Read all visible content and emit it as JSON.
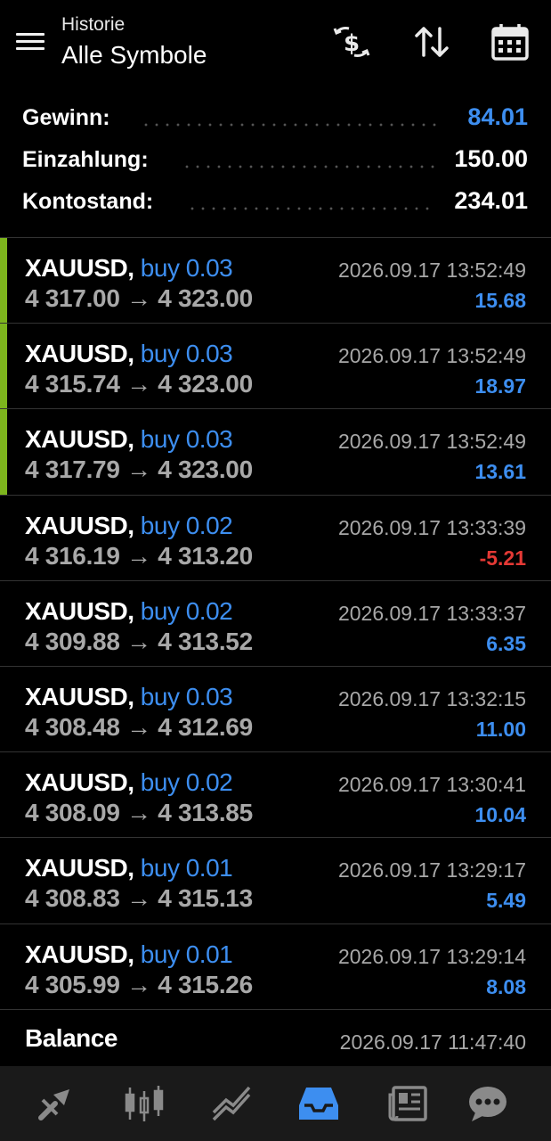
{
  "header": {
    "subtitle": "Historie",
    "title": "Alle Symbole",
    "icons": [
      "menu-icon",
      "currency-exchange-icon",
      "sort-icon",
      "calendar-icon"
    ]
  },
  "summary": {
    "profit_label": "Gewinn:",
    "profit_value": "84.01",
    "deposit_label": "Einzahlung:",
    "deposit_value": "150.00",
    "balance_label": "Kontostand:",
    "balance_value": "234.01"
  },
  "trades": [
    {
      "symbol": "XAUUSD,",
      "type": "buy 0.03",
      "prices": "4 317.00 → 4 323.00",
      "time": "2026.09.17 13:52:49",
      "profit": "15.68"
    },
    {
      "symbol": "XAUUSD,",
      "type": "buy 0.03",
      "prices": "4 315.74 → 4 323.00",
      "time": "2026.09.17 13:52:49",
      "profit": "18.97"
    },
    {
      "symbol": "XAUUSD,",
      "type": "buy 0.03",
      "prices": "4 317.79 → 4 323.00",
      "time": "2026.09.17 13:52:49",
      "profit": "13.61"
    },
    {
      "symbol": "XAUUSD,",
      "type": "buy 0.02",
      "prices": "4 316.19 → 4 313.20",
      "time": "2026.09.17 13:33:39",
      "profit": "-5.21"
    },
    {
      "symbol": "XAUUSD,",
      "type": "buy 0.02",
      "prices": "4 309.88 → 4 313.52",
      "time": "2026.09.17 13:33:37",
      "profit": "6.35"
    },
    {
      "symbol": "XAUUSD,",
      "type": "buy 0.03",
      "prices": "4 308.48 → 4 312.69",
      "time": "2026.09.17 13:32:15",
      "profit": "11.00"
    },
    {
      "symbol": "XAUUSD,",
      "type": "buy 0.02",
      "prices": "4 308.09 → 4 313.85",
      "time": "2026.09.17 13:30:41",
      "profit": "10.04"
    },
    {
      "symbol": "XAUUSD,",
      "type": "buy 0.01",
      "prices": "4 308.83 → 4 315.13",
      "time": "2026.09.17 13:29:17",
      "profit": "5.49"
    },
    {
      "symbol": "XAUUSD,",
      "type": "buy 0.01",
      "prices": "4 305.99 → 4 315.26",
      "time": "2026.09.17 13:29:14",
      "profit": "8.08"
    }
  ],
  "balance_row": {
    "label": "Balance",
    "time": "2026.09.17 11:47:40"
  },
  "bottom_nav": [
    "trade-icon",
    "chart-candles-icon",
    "trend-icon",
    "history-inbox-icon",
    "news-icon",
    "chat-icon"
  ],
  "colors": {
    "accent_blue": "#3d8ef0",
    "loss_red": "#e53935",
    "open_bar_green": "#7db51d",
    "nav_active": "#3d8ef0",
    "nav_inactive": "#8a8a8a"
  }
}
